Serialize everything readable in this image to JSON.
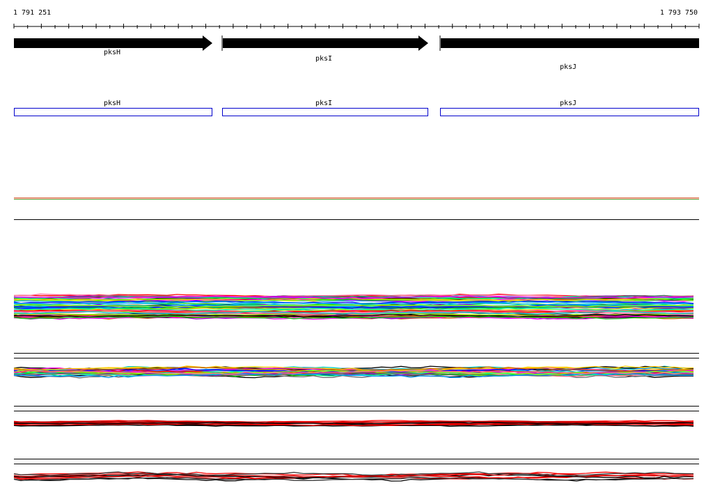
{
  "ruler": {
    "start_label": "1 791 251",
    "end_label": "1 793 750"
  },
  "genes": [
    {
      "name": "pksH"
    },
    {
      "name": "pksI"
    },
    {
      "name": "pksJ"
    }
  ],
  "features": [
    {
      "name": "pksH"
    },
    {
      "name": "pksI"
    },
    {
      "name": "pksJ"
    }
  ],
  "colors": {
    "gene_arrow": "#000000",
    "feature_box": "#0000cc",
    "track_line": "#000000",
    "annotation_line": "#cc3300",
    "annotation_line_2": "#669933"
  }
}
